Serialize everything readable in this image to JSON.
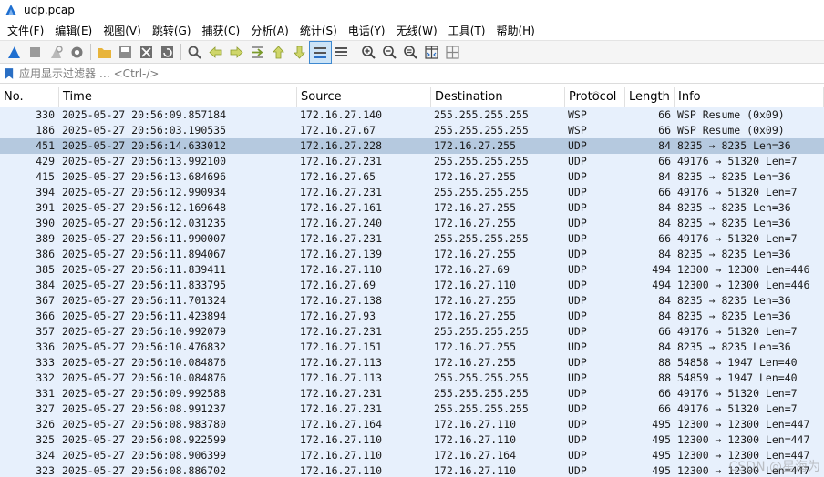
{
  "window": {
    "title": "udp.pcap"
  },
  "menu": [
    "文件(F)",
    "编辑(E)",
    "视图(V)",
    "跳转(G)",
    "捕获(C)",
    "分析(A)",
    "统计(S)",
    "电话(Y)",
    "无线(W)",
    "工具(T)",
    "帮助(H)"
  ],
  "toolbar": [
    {
      "icon": "shark-fin-start-icon"
    },
    {
      "icon": "stop-square-icon"
    },
    {
      "icon": "restart-fin-icon"
    },
    {
      "icon": "capture-options-gear-icon"
    },
    {
      "sep": true
    },
    {
      "icon": "open-folder-icon"
    },
    {
      "icon": "save-file-icon"
    },
    {
      "icon": "close-file-icon"
    },
    {
      "icon": "reload-icon"
    },
    {
      "sep": true
    },
    {
      "icon": "find-packet-icon"
    },
    {
      "icon": "go-back-icon"
    },
    {
      "icon": "go-forward-icon"
    },
    {
      "icon": "go-to-packet-icon"
    },
    {
      "icon": "go-first-packet-icon"
    },
    {
      "icon": "go-last-packet-icon"
    },
    {
      "icon": "auto-scroll-icon",
      "active": true
    },
    {
      "icon": "colorize-icon"
    },
    {
      "sep": true
    },
    {
      "icon": "zoom-in-icon"
    },
    {
      "icon": "zoom-out-icon"
    },
    {
      "icon": "zoom-normal-icon"
    },
    {
      "icon": "resize-columns-icon"
    },
    {
      "icon": "layout-grid-icon"
    }
  ],
  "filter": {
    "placeholder": "应用显示过滤器 … <Ctrl-/>"
  },
  "columns": {
    "no": "No.",
    "time": "Time",
    "source": "Source",
    "destination": "Destination",
    "protocol": "Protocol",
    "length": "Length",
    "info": "Info"
  },
  "packets": [
    {
      "no": "330",
      "time": "2025-05-27 20:56:09.857184",
      "src": "172.16.27.140",
      "dst": "255.255.255.255",
      "proto": "WSP",
      "len": "66",
      "info": "WSP Resume (0x09)"
    },
    {
      "no": "186",
      "time": "2025-05-27 20:56:03.190535",
      "src": "172.16.27.67",
      "dst": "255.255.255.255",
      "proto": "WSP",
      "len": "66",
      "info": "WSP Resume (0x09)"
    },
    {
      "no": "451",
      "time": "2025-05-27 20:56:14.633012",
      "src": "172.16.27.228",
      "dst": "172.16.27.255",
      "proto": "UDP",
      "len": "84",
      "info": "8235 → 8235 Len=36",
      "selected": true
    },
    {
      "no": "429",
      "time": "2025-05-27 20:56:13.992100",
      "src": "172.16.27.231",
      "dst": "255.255.255.255",
      "proto": "UDP",
      "len": "66",
      "info": "49176 → 51320 Len=7"
    },
    {
      "no": "415",
      "time": "2025-05-27 20:56:13.684696",
      "src": "172.16.27.65",
      "dst": "172.16.27.255",
      "proto": "UDP",
      "len": "84",
      "info": "8235 → 8235 Len=36"
    },
    {
      "no": "394",
      "time": "2025-05-27 20:56:12.990934",
      "src": "172.16.27.231",
      "dst": "255.255.255.255",
      "proto": "UDP",
      "len": "66",
      "info": "49176 → 51320 Len=7"
    },
    {
      "no": "391",
      "time": "2025-05-27 20:56:12.169648",
      "src": "172.16.27.161",
      "dst": "172.16.27.255",
      "proto": "UDP",
      "len": "84",
      "info": "8235 → 8235 Len=36"
    },
    {
      "no": "390",
      "time": "2025-05-27 20:56:12.031235",
      "src": "172.16.27.240",
      "dst": "172.16.27.255",
      "proto": "UDP",
      "len": "84",
      "info": "8235 → 8235 Len=36"
    },
    {
      "no": "389",
      "time": "2025-05-27 20:56:11.990007",
      "src": "172.16.27.231",
      "dst": "255.255.255.255",
      "proto": "UDP",
      "len": "66",
      "info": "49176 → 51320 Len=7"
    },
    {
      "no": "386",
      "time": "2025-05-27 20:56:11.894067",
      "src": "172.16.27.139",
      "dst": "172.16.27.255",
      "proto": "UDP",
      "len": "84",
      "info": "8235 → 8235 Len=36"
    },
    {
      "no": "385",
      "time": "2025-05-27 20:56:11.839411",
      "src": "172.16.27.110",
      "dst": "172.16.27.69",
      "proto": "UDP",
      "len": "494",
      "info": "12300 → 12300 Len=446"
    },
    {
      "no": "384",
      "time": "2025-05-27 20:56:11.833795",
      "src": "172.16.27.69",
      "dst": "172.16.27.110",
      "proto": "UDP",
      "len": "494",
      "info": "12300 → 12300 Len=446"
    },
    {
      "no": "367",
      "time": "2025-05-27 20:56:11.701324",
      "src": "172.16.27.138",
      "dst": "172.16.27.255",
      "proto": "UDP",
      "len": "84",
      "info": "8235 → 8235 Len=36"
    },
    {
      "no": "366",
      "time": "2025-05-27 20:56:11.423894",
      "src": "172.16.27.93",
      "dst": "172.16.27.255",
      "proto": "UDP",
      "len": "84",
      "info": "8235 → 8235 Len=36"
    },
    {
      "no": "357",
      "time": "2025-05-27 20:56:10.992079",
      "src": "172.16.27.231",
      "dst": "255.255.255.255",
      "proto": "UDP",
      "len": "66",
      "info": "49176 → 51320 Len=7"
    },
    {
      "no": "336",
      "time": "2025-05-27 20:56:10.476832",
      "src": "172.16.27.151",
      "dst": "172.16.27.255",
      "proto": "UDP",
      "len": "84",
      "info": "8235 → 8235 Len=36"
    },
    {
      "no": "333",
      "time": "2025-05-27 20:56:10.084876",
      "src": "172.16.27.113",
      "dst": "172.16.27.255",
      "proto": "UDP",
      "len": "88",
      "info": "54858 → 1947 Len=40"
    },
    {
      "no": "332",
      "time": "2025-05-27 20:56:10.084876",
      "src": "172.16.27.113",
      "dst": "255.255.255.255",
      "proto": "UDP",
      "len": "88",
      "info": "54859 → 1947 Len=40"
    },
    {
      "no": "331",
      "time": "2025-05-27 20:56:09.992588",
      "src": "172.16.27.231",
      "dst": "255.255.255.255",
      "proto": "UDP",
      "len": "66",
      "info": "49176 → 51320 Len=7"
    },
    {
      "no": "327",
      "time": "2025-05-27 20:56:08.991237",
      "src": "172.16.27.231",
      "dst": "255.255.255.255",
      "proto": "UDP",
      "len": "66",
      "info": "49176 → 51320 Len=7"
    },
    {
      "no": "326",
      "time": "2025-05-27 20:56:08.983780",
      "src": "172.16.27.164",
      "dst": "172.16.27.110",
      "proto": "UDP",
      "len": "495",
      "info": "12300 → 12300 Len=447"
    },
    {
      "no": "325",
      "time": "2025-05-27 20:56:08.922599",
      "src": "172.16.27.110",
      "dst": "172.16.27.110",
      "proto": "UDP",
      "len": "495",
      "info": "12300 → 12300 Len=447"
    },
    {
      "no": "324",
      "time": "2025-05-27 20:56:08.906399",
      "src": "172.16.27.110",
      "dst": "172.16.27.164",
      "proto": "UDP",
      "len": "495",
      "info": "12300 → 12300 Len=447"
    },
    {
      "no": "323",
      "time": "2025-05-27 20:56:08.886702",
      "src": "172.16.27.110",
      "dst": "172.16.27.110",
      "proto": "UDP",
      "len": "495",
      "info": "12300 → 12300 Len=447"
    }
  ],
  "colors": {
    "row_bg": "#e7f0fc",
    "selected_bg": "#b5c9df",
    "accent": "#2a6fc4"
  },
  "watermark": "CSDN @星海为"
}
